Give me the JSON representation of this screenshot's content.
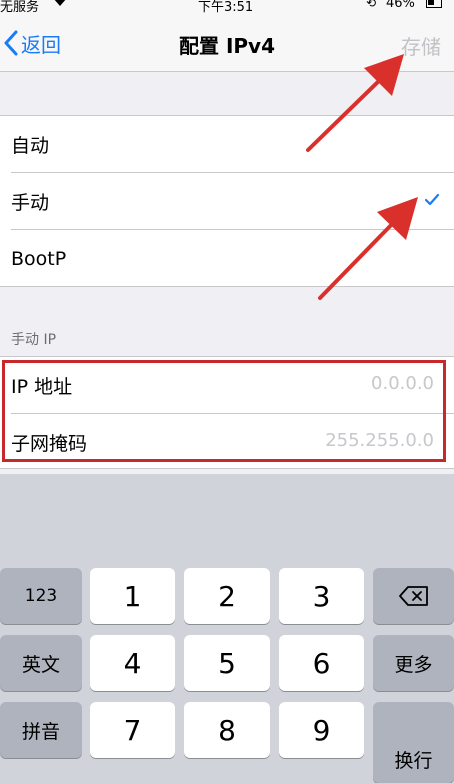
{
  "status_bar": {
    "carrier": "无服务",
    "time": "下午3:51",
    "battery": "46%",
    "icons": [
      "wifi-icon",
      "orientation-lock-icon",
      "battery-icon"
    ]
  },
  "nav": {
    "back_label": "返回",
    "title": "配置 IPv4",
    "save_label": "存储",
    "accent_color": "#1a7cf5"
  },
  "modes": [
    {
      "label": "自动",
      "selected": false
    },
    {
      "label": "手动",
      "selected": true
    },
    {
      "label": "BootP",
      "selected": false
    }
  ],
  "manual_section": {
    "header": "手动 IP",
    "fields": [
      {
        "label": "IP 地址",
        "placeholder": "0.0.0.0"
      },
      {
        "label": "子网掩码",
        "placeholder": "255.255.0.0"
      }
    ]
  },
  "keyboard": {
    "left_column": [
      "123",
      "英文",
      "拼音"
    ],
    "digits": [
      "1",
      "2",
      "3",
      "4",
      "5",
      "6",
      "7",
      "8",
      "9"
    ],
    "right_column": {
      "delete": "delete-icon",
      "more": "更多",
      "return": "换行"
    }
  },
  "annotations": {
    "highlight_color": "#c6282b"
  }
}
